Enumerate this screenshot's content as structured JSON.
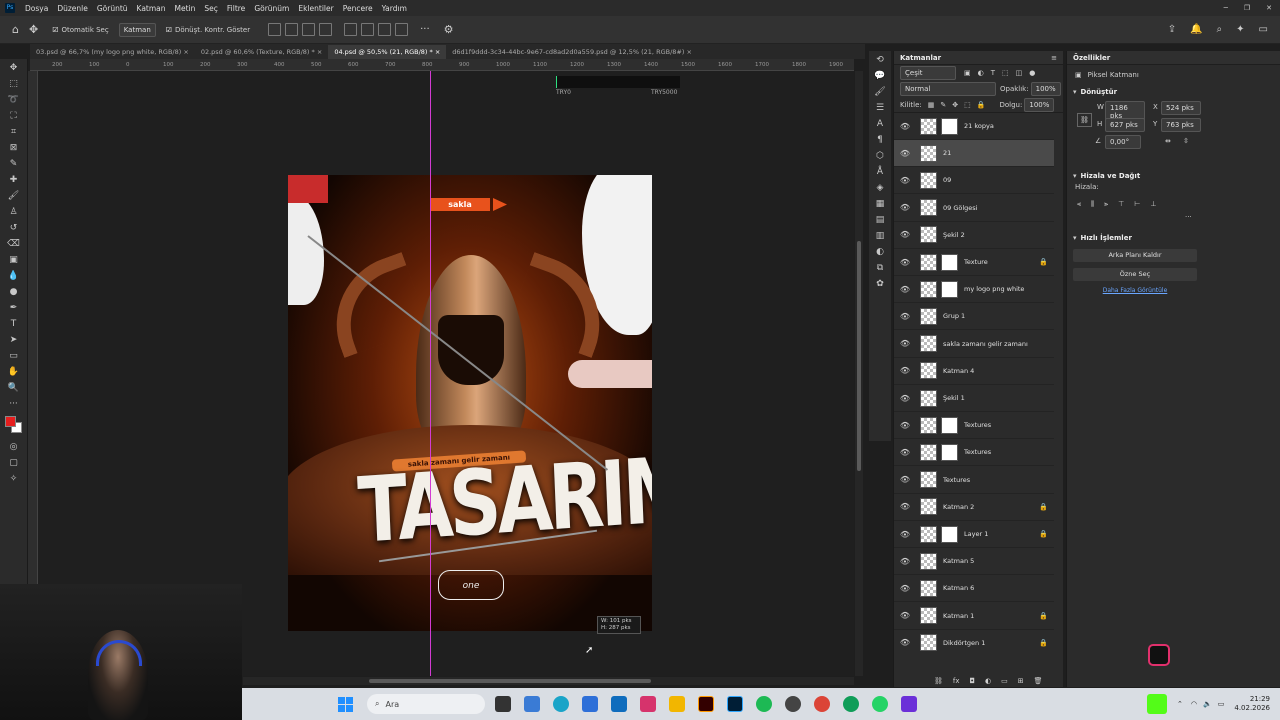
{
  "menu": [
    "Dosya",
    "Düzenle",
    "Görüntü",
    "Katman",
    "Metin",
    "Seç",
    "Filtre",
    "Görünüm",
    "Eklentiler",
    "Pencere",
    "Yardım"
  ],
  "options": {
    "autoselect": "Otomatik Seç",
    "target": "Katman",
    "transform": "Dönüşt. Kontr. Göster",
    "more": "···"
  },
  "tabs": [
    {
      "label": "03.psd @ 66,7% (my logo png white, RGB/8)",
      "active": false
    },
    {
      "label": "02.psd @ 60,6% (Texture, RGB/8) *",
      "active": false
    },
    {
      "label": "04.psd @ 50,5% (21, RGB/8) *",
      "active": true
    },
    {
      "label": "d6d1f9ddd-3c34-44bc-9e67-cd8ad2d0a559.psd @ 12,5% (21, RGB/8#)",
      "active": false
    }
  ],
  "ruler": [
    "200",
    "100",
    "0",
    "100",
    "200",
    "300",
    "400",
    "500",
    "600",
    "700",
    "800",
    "900",
    "1000",
    "1100",
    "1200",
    "1300",
    "1400",
    "1500",
    "1600",
    "1700",
    "1800",
    "1900"
  ],
  "artboard": {
    "tag1": "TRY0",
    "tag2": "TRY5000"
  },
  "poster": {
    "brand": "sakla",
    "subtitle": "sakla zamanı gelir zamanı",
    "headline": "TASARIM",
    "logo": "one"
  },
  "readout": {
    "w": "W: 101 pks",
    "h": "H: 287 pks"
  },
  "layers_panel": {
    "title": "Katmanlar",
    "filter": "Çeşit",
    "blend": "Normal",
    "opacity_label": "Opaklık:",
    "opacity": "100%",
    "lock_label": "Kilitle:",
    "fill_label": "Dolgu:",
    "fill": "100%",
    "items": [
      {
        "name": "21 kopya",
        "mask": true,
        "lock": false,
        "sel": false
      },
      {
        "name": "21",
        "mask": false,
        "lock": false,
        "sel": true
      },
      {
        "name": "09",
        "mask": false,
        "lock": false,
        "sel": false
      },
      {
        "name": "09 Gölgesi",
        "mask": false,
        "lock": false,
        "sel": false
      },
      {
        "name": "Şekil 2",
        "mask": false,
        "lock": false,
        "sel": false
      },
      {
        "name": "Texture",
        "mask": true,
        "lock": true,
        "sel": false
      },
      {
        "name": "my logo png white",
        "mask": true,
        "lock": false,
        "sel": false
      },
      {
        "name": "Grup 1",
        "mask": false,
        "lock": false,
        "sel": false
      },
      {
        "name": "sakla zamanı gelir zamanı",
        "mask": false,
        "lock": false,
        "sel": false
      },
      {
        "name": "Katman 4",
        "mask": false,
        "lock": false,
        "sel": false
      },
      {
        "name": "Şekil 1",
        "mask": false,
        "lock": false,
        "sel": false
      },
      {
        "name": "Textures",
        "mask": true,
        "lock": false,
        "sel": false
      },
      {
        "name": "Textures",
        "mask": true,
        "lock": false,
        "sel": false
      },
      {
        "name": "Textures",
        "mask": false,
        "lock": false,
        "sel": false
      },
      {
        "name": "Katman 2",
        "mask": false,
        "lock": true,
        "sel": false
      },
      {
        "name": "Layer 1",
        "mask": true,
        "lock": true,
        "sel": false
      },
      {
        "name": "Katman 5",
        "mask": false,
        "lock": false,
        "sel": false
      },
      {
        "name": "Katman 6",
        "mask": false,
        "lock": false,
        "sel": false
      },
      {
        "name": "Katman 1",
        "mask": false,
        "lock": true,
        "sel": false
      },
      {
        "name": "Dikdörtgen 1",
        "mask": false,
        "lock": true,
        "sel": false
      }
    ]
  },
  "properties": {
    "title": "Özellikler",
    "kind": "Piksel Katmanı",
    "transform": "Dönüştür",
    "W": "1186 pks",
    "X": "524 pks",
    "H": "627 pks",
    "Y": "763 pks",
    "angle": "0,00°",
    "align": "Hizala ve Dağıt",
    "align_sub": "Hizala:",
    "quick": "Hızlı İşlemler",
    "btn1": "Arka Planı Kaldır",
    "btn2": "Özne Seç",
    "link": "Daha Fazla Görüntüle"
  },
  "taskbar": {
    "search": "Ara",
    "time": "21:29",
    "date": "4.02.2026"
  },
  "colors": {
    "fg": "#e61e1e",
    "bg": "#ffffff",
    "accent": "#d23bd2"
  }
}
